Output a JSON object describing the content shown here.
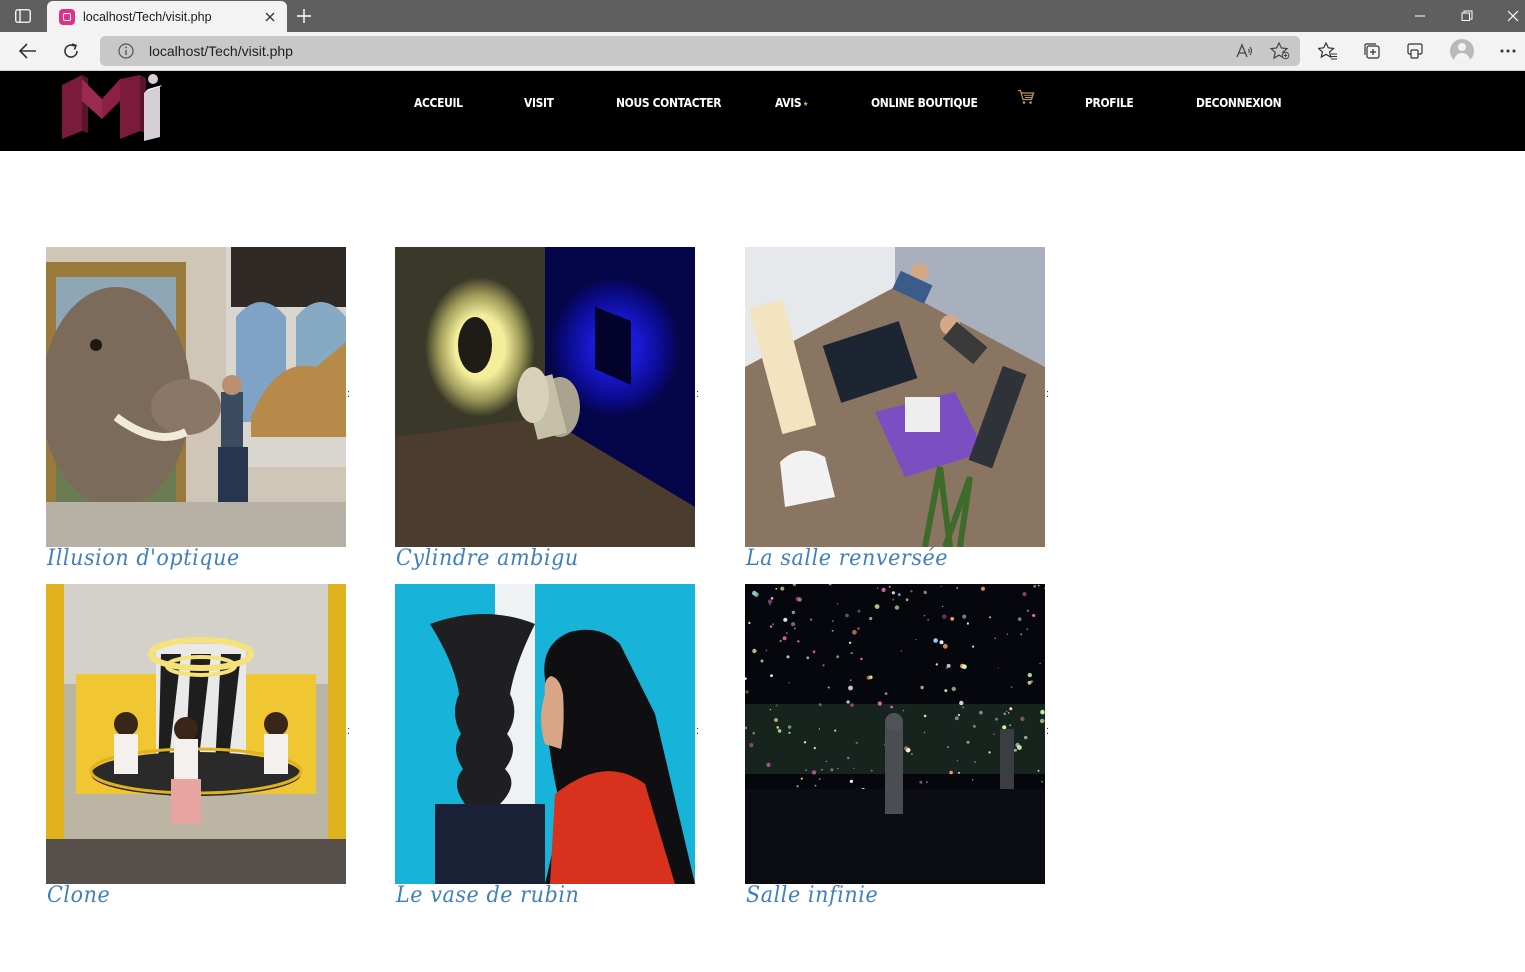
{
  "browser": {
    "tab_title": "localhost/Tech/visit.php",
    "url": "localhost/Tech/visit.php",
    "icons": [
      "sidebar-icon",
      "close-icon",
      "new-tab-icon",
      "minimize-icon",
      "restore-icon",
      "close-window-icon",
      "back-icon",
      "refresh-icon",
      "info-icon",
      "read-aloud-icon",
      "add-favorite-icon",
      "favorites-icon",
      "collections-icon",
      "extensions-icon",
      "profile-avatar",
      "more-icon"
    ]
  },
  "site": {
    "logo_alt": "logo",
    "nav": [
      {
        "label": "ACCEUIL"
      },
      {
        "label": "VISIT"
      },
      {
        "label": "NOUS CONTACTER"
      },
      {
        "label": "AVIS"
      },
      {
        "label": "ONLINE BOUTIQUE"
      },
      {
        "label": "PROFILE"
      },
      {
        "label": "DECONNEXION"
      }
    ],
    "avis_star": "★",
    "cart_icon": "shopping-cart-icon"
  },
  "colors": {
    "header_bg": "#000000",
    "nav_text": "#ffffff",
    "caption": "#3f7fc1",
    "logo_red": "#8b1f45",
    "logo_gray": "#d5d0d6"
  },
  "gallery": {
    "items": [
      {
        "caption": "Illusion d'optique",
        "separator": ":"
      },
      {
        "caption": "Cylindre ambigu",
        "separator": ":"
      },
      {
        "caption": "La salle renversée",
        "separator": ":"
      },
      {
        "caption": "Clone",
        "separator": ":"
      },
      {
        "caption": "Le vase de rubin",
        "separator": ":"
      },
      {
        "caption": "Salle infinie",
        "separator": ":"
      }
    ]
  }
}
